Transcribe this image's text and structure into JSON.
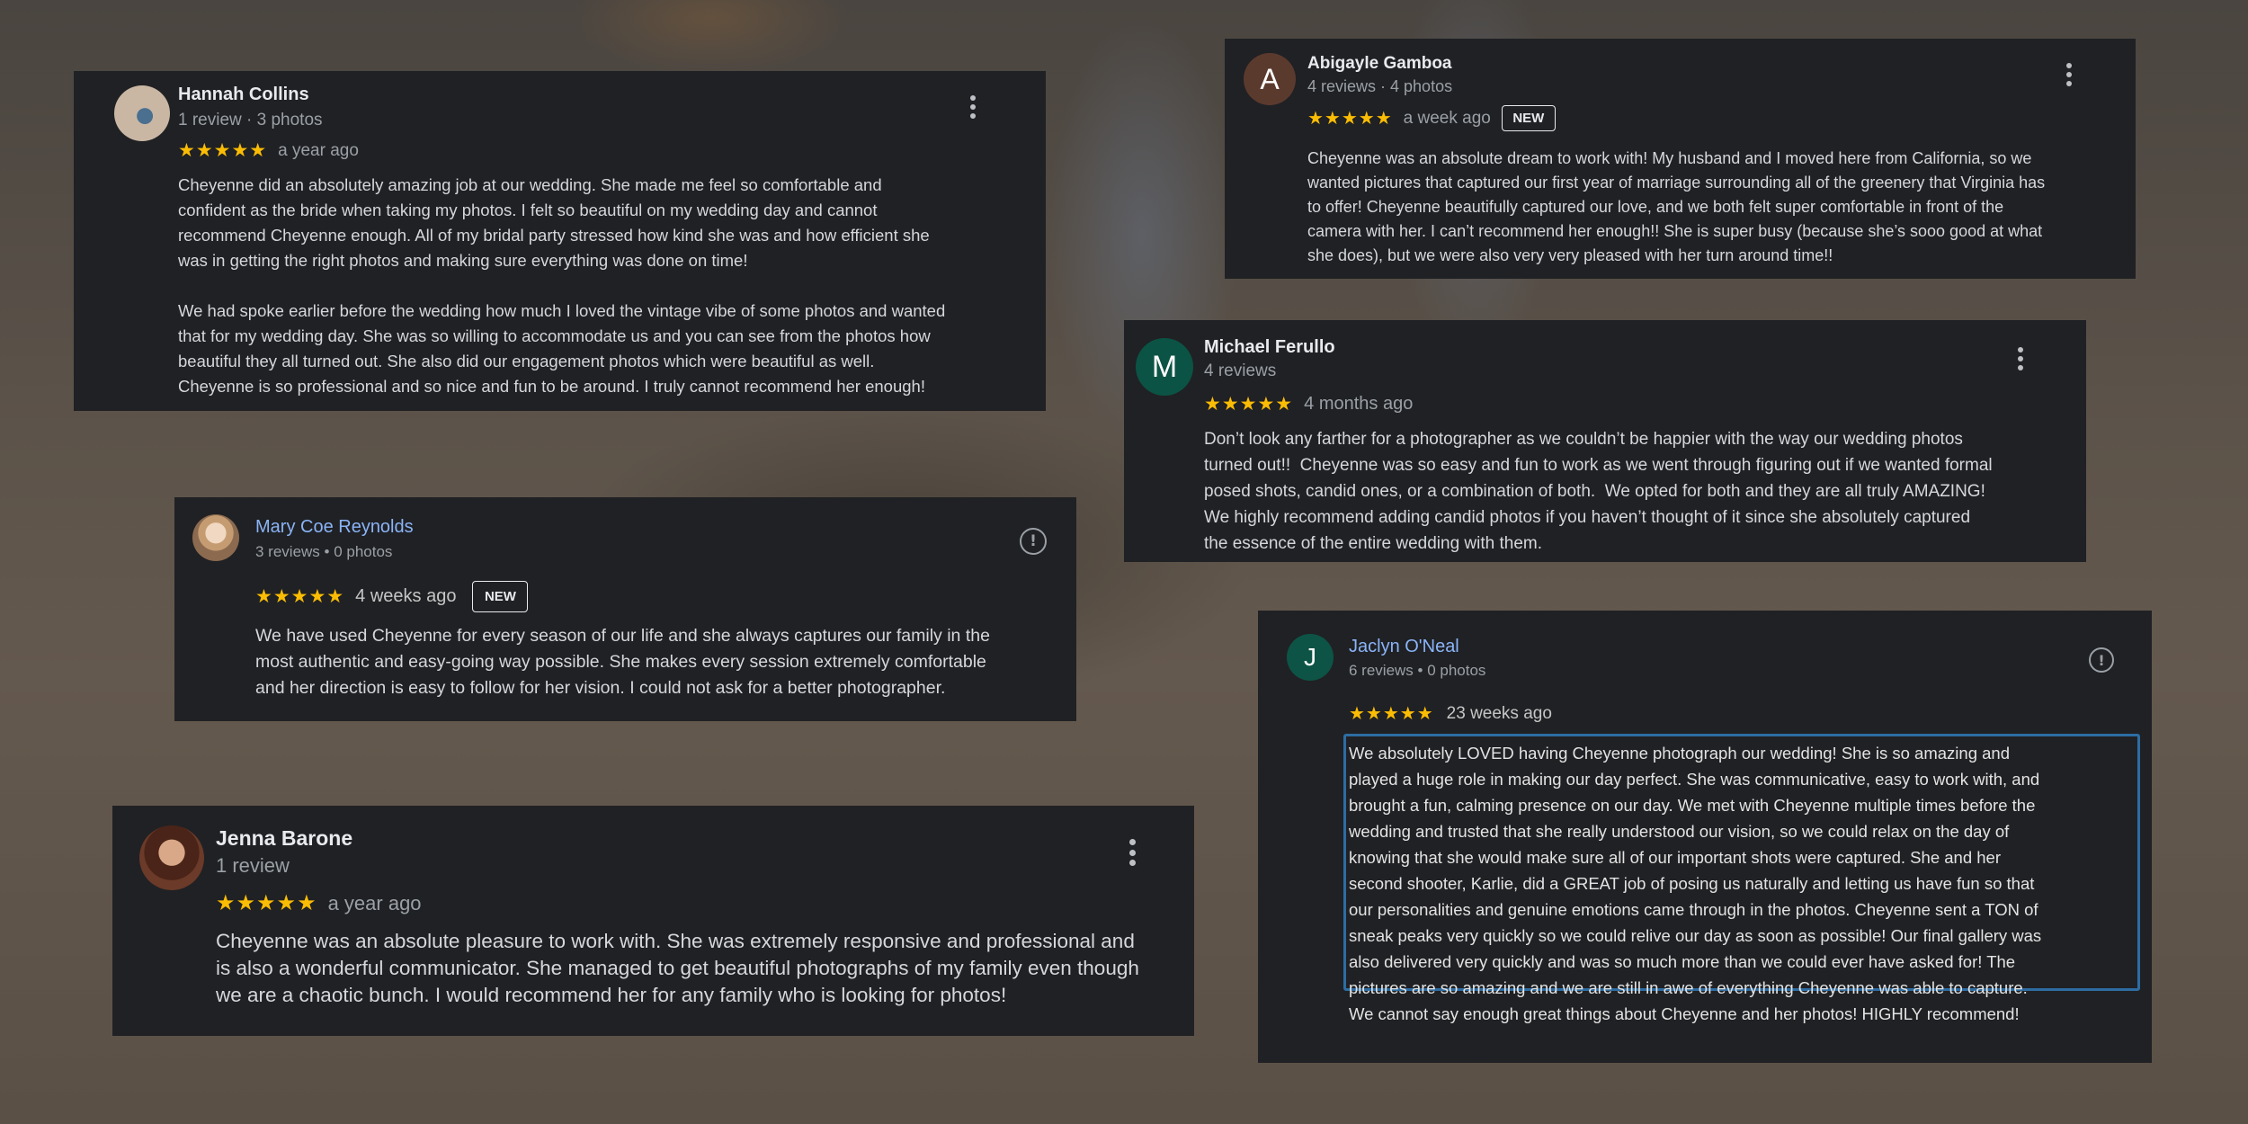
{
  "reviews": {
    "hannah": {
      "name": "Hannah Collins",
      "meta": "1 review · 3 photos",
      "stars": "★★★★★",
      "when": "a year ago",
      "text": "Cheyenne did an absolutely amazing job at our wedding. She made me feel so comfortable and\nconfident as the bride when taking my photos. I felt so beautiful on my wedding day and cannot\nrecommend Cheyenne enough. All of my bridal party stressed how kind she was and how efficient she\nwas in getting the right photos and making sure everything was done on time!\n\nWe had spoke earlier before the wedding how much I loved the vintage vibe of some photos and wanted\nthat for my wedding day. She was so willing to accommodate us and you can see from the photos how\nbeautiful they all turned out. She also did our engagement photos which were beautiful as well.\nCheyenne is so professional and so nice and fun to be around. I truly cannot recommend her enough!"
    },
    "abigayle": {
      "name": "Abigayle Gamboa",
      "initial": "A",
      "meta": "4 reviews · 4 photos",
      "stars": "★★★★★",
      "when": "a week ago",
      "badge": "NEW",
      "text": "Cheyenne was an absolute dream to work with! My husband and I moved here from California, so we\nwanted pictures that captured our first year of marriage surrounding all of the greenery that Virginia has\nto offer! Cheyenne beautifully captured our love, and we both felt super comfortable in front of the\ncamera with her. I can’t recommend her enough!! She is super busy (because she’s sooo good at what\nshe does), but we were also very very pleased with her turn around time!!"
    },
    "michael": {
      "name": "Michael Ferullo",
      "initial": "M",
      "meta": "4 reviews",
      "stars": "★★★★★",
      "when": "4 months ago",
      "text": "Don’t look any farther for a photographer as we couldn’t be happier with the way our wedding photos\nturned out!!  Cheyenne was so easy and fun to work as we went through figuring out if we wanted formal\nposed shots, candid ones, or a combination of both.  We opted for both and they are all truly AMAZING!\nWe highly recommend adding candid photos if you haven’t thought of it since she absolutely captured\nthe essence of the entire wedding with them."
    },
    "mary": {
      "name": "Mary Coe Reynolds",
      "meta": "3 reviews • 0 photos",
      "stars": "★★★★★",
      "when": "4 weeks ago",
      "badge": "NEW",
      "text": "We have used Cheyenne for every season of our life and she always captures our family in the\nmost authentic and easy-going way possible. She makes every session extremely comfortable\nand her direction is easy to follow for her vision. I could not ask for a better photographer."
    },
    "jaclyn": {
      "name": "Jaclyn O'Neal",
      "initial": "J",
      "meta": "6 reviews • 0 photos",
      "stars": "★★★★★",
      "when": "23 weeks ago",
      "text": "We absolutely LOVED having Cheyenne photograph our wedding! She is so amazing and\nplayed a huge role in making our day perfect. She was communicative, easy to work with, and\nbrought a fun, calming presence on our day. We met with Cheyenne multiple times before the\nwedding and trusted that she really understood our vision, so we could relax on the day of\nknowing that she would make sure all of our important shots were captured. She and her\nsecond shooter, Karlie, did a GREAT job of posing us naturally and letting us have fun so that\nour personalities and genuine emotions came through in the photos. Cheyenne sent a TON of\nsneak peaks very quickly so we could relive our day as soon as possible! Our final gallery was\nalso delivered very quickly and was so much more than we could ever have asked for! The\npictures are so amazing and we are still in awe of everything Cheyenne was able to capture.\nWe cannot say enough great things about Cheyenne and her photos! HIGHLY recommend!"
    },
    "jenna": {
      "name": "Jenna Barone",
      "meta": "1 review",
      "stars": "★★★★★",
      "when": "a year ago",
      "text": "Cheyenne was an absolute pleasure to work with. She was extremely responsive and professional and\nis also a wonderful communicator. She managed to get beautiful photographs of my family even though\nwe are a chaotic bunch. I would recommend her for any family who is looking for photos!"
    }
  },
  "colors": {
    "card_bg": "#202124",
    "star": "#fbbc04",
    "link": "#8ab4f8",
    "abigayle_avatar": "#5b3a2e",
    "michael_avatar": "#0b5345",
    "jaclyn_avatar": "#0d5446",
    "highlight_border": "#2d6da3"
  },
  "icons": {
    "more": "more-vert-icon",
    "report": "report-icon"
  }
}
